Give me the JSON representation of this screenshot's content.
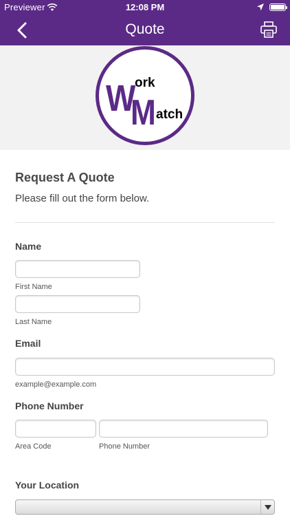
{
  "status_bar": {
    "carrier": "Previewer",
    "time": "12:08 PM"
  },
  "nav": {
    "title": "Quote",
    "back_icon": "chevron-left-icon",
    "print_icon": "printer-icon"
  },
  "logo": {
    "letters_big": [
      "W",
      "M"
    ],
    "letters_small": [
      "ork",
      "atch"
    ],
    "brand_color": "#5b2a86"
  },
  "form": {
    "heading": "Request A Quote",
    "subheading": "Please fill out the form below.",
    "name": {
      "label": "Name",
      "first_sublabel": "First Name",
      "last_sublabel": "Last Name"
    },
    "email": {
      "label": "Email",
      "sublabel": "example@example.com"
    },
    "phone": {
      "label": "Phone Number",
      "area_sublabel": "Area Code",
      "number_sublabel": "Phone Number"
    },
    "location": {
      "label": "Your Location",
      "selected": ""
    }
  }
}
